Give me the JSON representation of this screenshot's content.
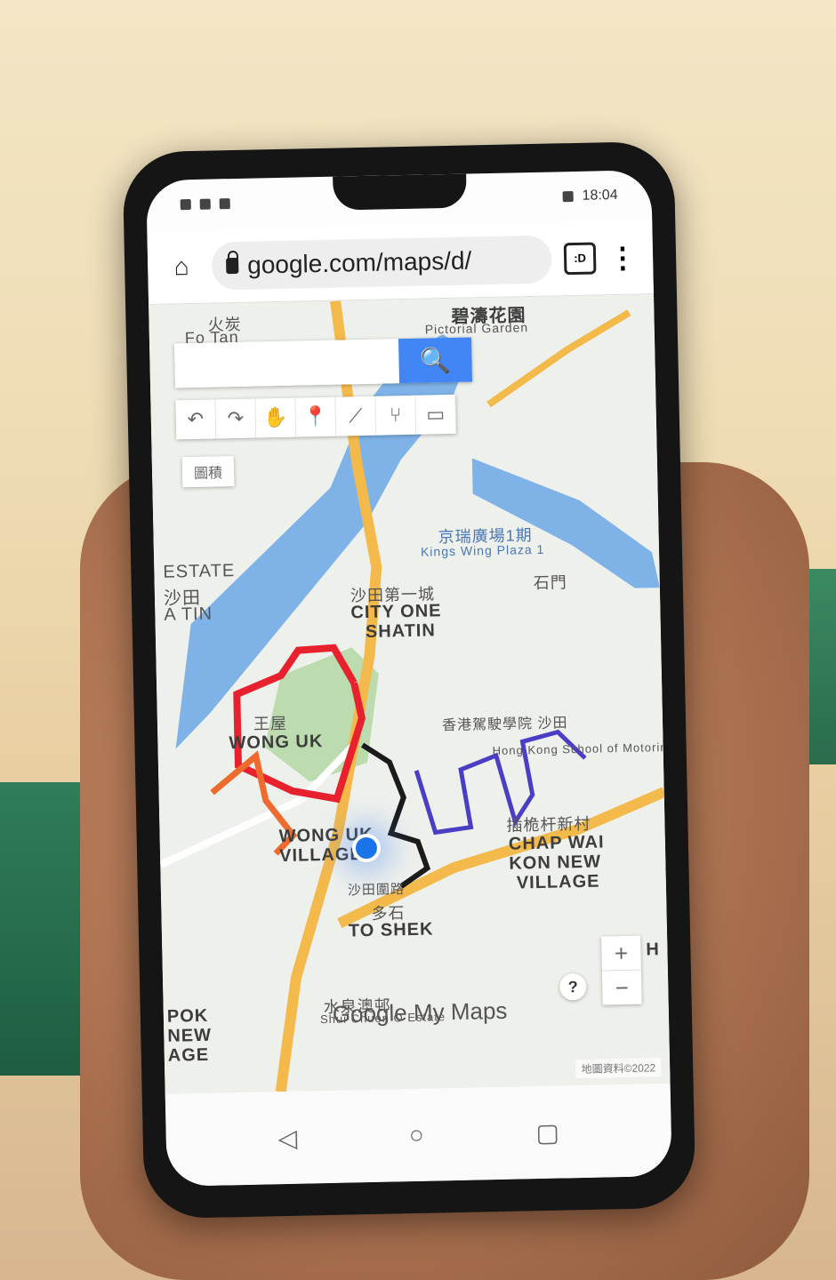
{
  "status_bar": {
    "time": "18:04"
  },
  "browser": {
    "url": "google.com/maps/d/",
    "tab_switcher_label": ":D"
  },
  "map": {
    "search_placeholder": "",
    "layer_button_label": "圖積",
    "brand": {
      "google": "Google",
      "my_maps": "My Maps"
    },
    "attribution": "地圖資料©2022",
    "labels": {
      "fotan_zh": "火炭",
      "fotan_en": "Fo Tan",
      "pictorial_zh": "碧濤花園",
      "pictorial_en": "Pictorial Garden",
      "hong_kong": "Hong Kong",
      "estate": "ESTATE",
      "shatin_zh": "沙田",
      "tin": "A TIN",
      "kings_wing_zh": "京瑞廣場1期",
      "kings_wing_en": "Kings Wing Plaza 1",
      "shek_mun": "石門",
      "city_one_zh": "沙田第一城",
      "city_one_en1": "CITY ONE",
      "city_one_en2": "SHATIN",
      "wong_uk_zh": "王屋",
      "wong_uk_en": "WONG UK",
      "village_en1": "WONG UK",
      "village_en2": "VILLAGE",
      "school_zh": "香港駕駛學院 沙田",
      "school_en": "Hong Kong School of Motoring",
      "chap_wai_zh": "插桅杆新村",
      "chap_wai_en1": "CHAP WAI",
      "chap_wai_en2": "KON NEW",
      "chap_wai_en3": "VILLAGE",
      "shatin_rd": "沙田圍路",
      "to_shek_zh": "多石",
      "to_shek_en": "TO SHEK",
      "shui_chuen_zh": "水泉澳邨",
      "shui_chuen_en": "Shui Chuen O Estate",
      "pok_en1": "POK",
      "pok_en2": "NEW",
      "pok_en3": "AGE",
      "h_edge": "H"
    }
  }
}
